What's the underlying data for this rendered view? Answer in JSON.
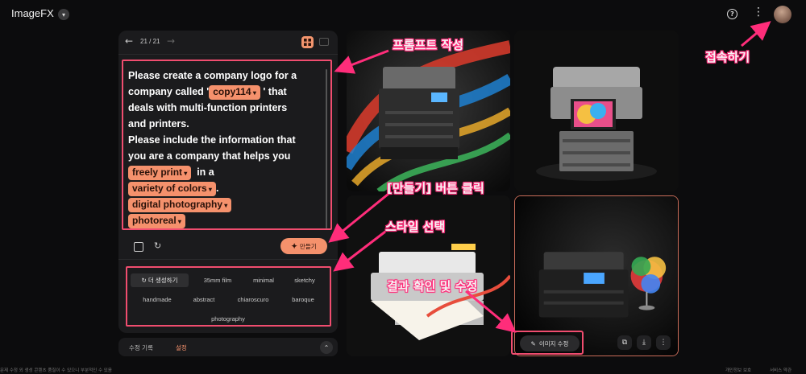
{
  "header": {
    "app_title": "ImageFX",
    "title_chevron": "▾",
    "help_icon": "?",
    "more_icon": "⋮"
  },
  "navigation": {
    "count": "21 / 21",
    "back_icon": "←",
    "forward_icon": "→"
  },
  "prompt": {
    "line1": "Please create a company logo for a",
    "line2a": "company called '",
    "chip_name": "copy114",
    "line2b": " ' that",
    "line3": "deals with multi-function printers",
    "line4": "and printers.",
    "line5": "Please include the information that",
    "line6": "you are a company that helps you",
    "chip_print": "freely print",
    "line7b": "  in a",
    "chip_colors": "variety of colors",
    "line8b": ".",
    "chip_photo": "digital photography",
    "chip_real": "photoreal"
  },
  "actions": {
    "make_button": "만들기",
    "make_plus": "✦",
    "refresh_icon": "↻"
  },
  "styles": {
    "items": [
      {
        "label": "↻  더 생성하기"
      },
      {
        "label": "35mm film"
      },
      {
        "label": "minimal"
      },
      {
        "label": "sketchy"
      },
      {
        "label": "handmade"
      },
      {
        "label": "abstract"
      },
      {
        "label": "chiaroscuro"
      },
      {
        "label": "baroque"
      },
      {
        "label": "photography"
      }
    ]
  },
  "tabs": {
    "history": "수정 기록",
    "settings": "설정",
    "expand_icon": "⌃"
  },
  "footer": {
    "left": "문제 수정 외 생성 콘텐츠 품질이 수 있으니 부분적인 수 있음",
    "right1": "개인정보 보호",
    "right2": "서비스 약관"
  },
  "image_tools": {
    "edit_label": "이미지 수정",
    "edit_icon": "✎",
    "copy_icon": "⧉",
    "download_icon": "⤓",
    "more_icon": "⋮"
  },
  "annotations": {
    "prompt_write": "프롬프트 작성",
    "login": "접속하기",
    "make_click": "[만들기] 버튼 클릭",
    "style_select": "스타일 선택",
    "result_edit": "결과 확인 및 수정"
  },
  "colors": {
    "accent": "#f5916c",
    "highlight": "#f04d6f",
    "panel": "#1b1b1d",
    "background": "#0c0c0d"
  }
}
